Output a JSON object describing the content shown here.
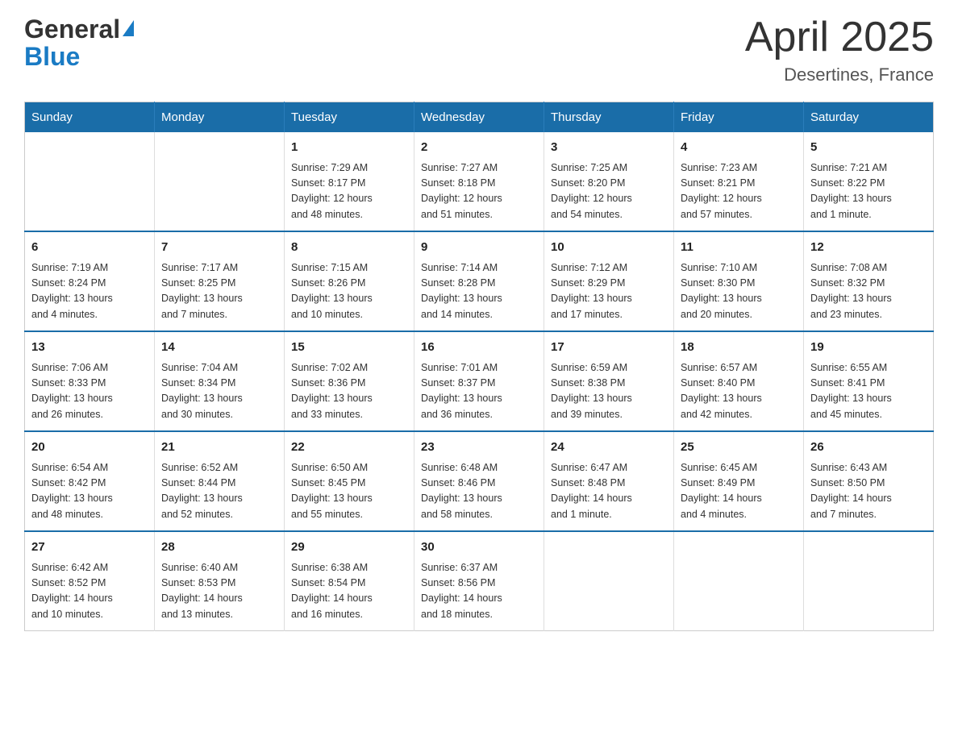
{
  "header": {
    "logo_line1": "General",
    "logo_line2": "Blue",
    "title": "April 2025",
    "subtitle": "Desertines, France"
  },
  "calendar": {
    "days_of_week": [
      "Sunday",
      "Monday",
      "Tuesday",
      "Wednesday",
      "Thursday",
      "Friday",
      "Saturday"
    ],
    "weeks": [
      [
        {
          "day": "",
          "info": ""
        },
        {
          "day": "",
          "info": ""
        },
        {
          "day": "1",
          "info": "Sunrise: 7:29 AM\nSunset: 8:17 PM\nDaylight: 12 hours\nand 48 minutes."
        },
        {
          "day": "2",
          "info": "Sunrise: 7:27 AM\nSunset: 8:18 PM\nDaylight: 12 hours\nand 51 minutes."
        },
        {
          "day": "3",
          "info": "Sunrise: 7:25 AM\nSunset: 8:20 PM\nDaylight: 12 hours\nand 54 minutes."
        },
        {
          "day": "4",
          "info": "Sunrise: 7:23 AM\nSunset: 8:21 PM\nDaylight: 12 hours\nand 57 minutes."
        },
        {
          "day": "5",
          "info": "Sunrise: 7:21 AM\nSunset: 8:22 PM\nDaylight: 13 hours\nand 1 minute."
        }
      ],
      [
        {
          "day": "6",
          "info": "Sunrise: 7:19 AM\nSunset: 8:24 PM\nDaylight: 13 hours\nand 4 minutes."
        },
        {
          "day": "7",
          "info": "Sunrise: 7:17 AM\nSunset: 8:25 PM\nDaylight: 13 hours\nand 7 minutes."
        },
        {
          "day": "8",
          "info": "Sunrise: 7:15 AM\nSunset: 8:26 PM\nDaylight: 13 hours\nand 10 minutes."
        },
        {
          "day": "9",
          "info": "Sunrise: 7:14 AM\nSunset: 8:28 PM\nDaylight: 13 hours\nand 14 minutes."
        },
        {
          "day": "10",
          "info": "Sunrise: 7:12 AM\nSunset: 8:29 PM\nDaylight: 13 hours\nand 17 minutes."
        },
        {
          "day": "11",
          "info": "Sunrise: 7:10 AM\nSunset: 8:30 PM\nDaylight: 13 hours\nand 20 minutes."
        },
        {
          "day": "12",
          "info": "Sunrise: 7:08 AM\nSunset: 8:32 PM\nDaylight: 13 hours\nand 23 minutes."
        }
      ],
      [
        {
          "day": "13",
          "info": "Sunrise: 7:06 AM\nSunset: 8:33 PM\nDaylight: 13 hours\nand 26 minutes."
        },
        {
          "day": "14",
          "info": "Sunrise: 7:04 AM\nSunset: 8:34 PM\nDaylight: 13 hours\nand 30 minutes."
        },
        {
          "day": "15",
          "info": "Sunrise: 7:02 AM\nSunset: 8:36 PM\nDaylight: 13 hours\nand 33 minutes."
        },
        {
          "day": "16",
          "info": "Sunrise: 7:01 AM\nSunset: 8:37 PM\nDaylight: 13 hours\nand 36 minutes."
        },
        {
          "day": "17",
          "info": "Sunrise: 6:59 AM\nSunset: 8:38 PM\nDaylight: 13 hours\nand 39 minutes."
        },
        {
          "day": "18",
          "info": "Sunrise: 6:57 AM\nSunset: 8:40 PM\nDaylight: 13 hours\nand 42 minutes."
        },
        {
          "day": "19",
          "info": "Sunrise: 6:55 AM\nSunset: 8:41 PM\nDaylight: 13 hours\nand 45 minutes."
        }
      ],
      [
        {
          "day": "20",
          "info": "Sunrise: 6:54 AM\nSunset: 8:42 PM\nDaylight: 13 hours\nand 48 minutes."
        },
        {
          "day": "21",
          "info": "Sunrise: 6:52 AM\nSunset: 8:44 PM\nDaylight: 13 hours\nand 52 minutes."
        },
        {
          "day": "22",
          "info": "Sunrise: 6:50 AM\nSunset: 8:45 PM\nDaylight: 13 hours\nand 55 minutes."
        },
        {
          "day": "23",
          "info": "Sunrise: 6:48 AM\nSunset: 8:46 PM\nDaylight: 13 hours\nand 58 minutes."
        },
        {
          "day": "24",
          "info": "Sunrise: 6:47 AM\nSunset: 8:48 PM\nDaylight: 14 hours\nand 1 minute."
        },
        {
          "day": "25",
          "info": "Sunrise: 6:45 AM\nSunset: 8:49 PM\nDaylight: 14 hours\nand 4 minutes."
        },
        {
          "day": "26",
          "info": "Sunrise: 6:43 AM\nSunset: 8:50 PM\nDaylight: 14 hours\nand 7 minutes."
        }
      ],
      [
        {
          "day": "27",
          "info": "Sunrise: 6:42 AM\nSunset: 8:52 PM\nDaylight: 14 hours\nand 10 minutes."
        },
        {
          "day": "28",
          "info": "Sunrise: 6:40 AM\nSunset: 8:53 PM\nDaylight: 14 hours\nand 13 minutes."
        },
        {
          "day": "29",
          "info": "Sunrise: 6:38 AM\nSunset: 8:54 PM\nDaylight: 14 hours\nand 16 minutes."
        },
        {
          "day": "30",
          "info": "Sunrise: 6:37 AM\nSunset: 8:56 PM\nDaylight: 14 hours\nand 18 minutes."
        },
        {
          "day": "",
          "info": ""
        },
        {
          "day": "",
          "info": ""
        },
        {
          "day": "",
          "info": ""
        }
      ]
    ]
  }
}
